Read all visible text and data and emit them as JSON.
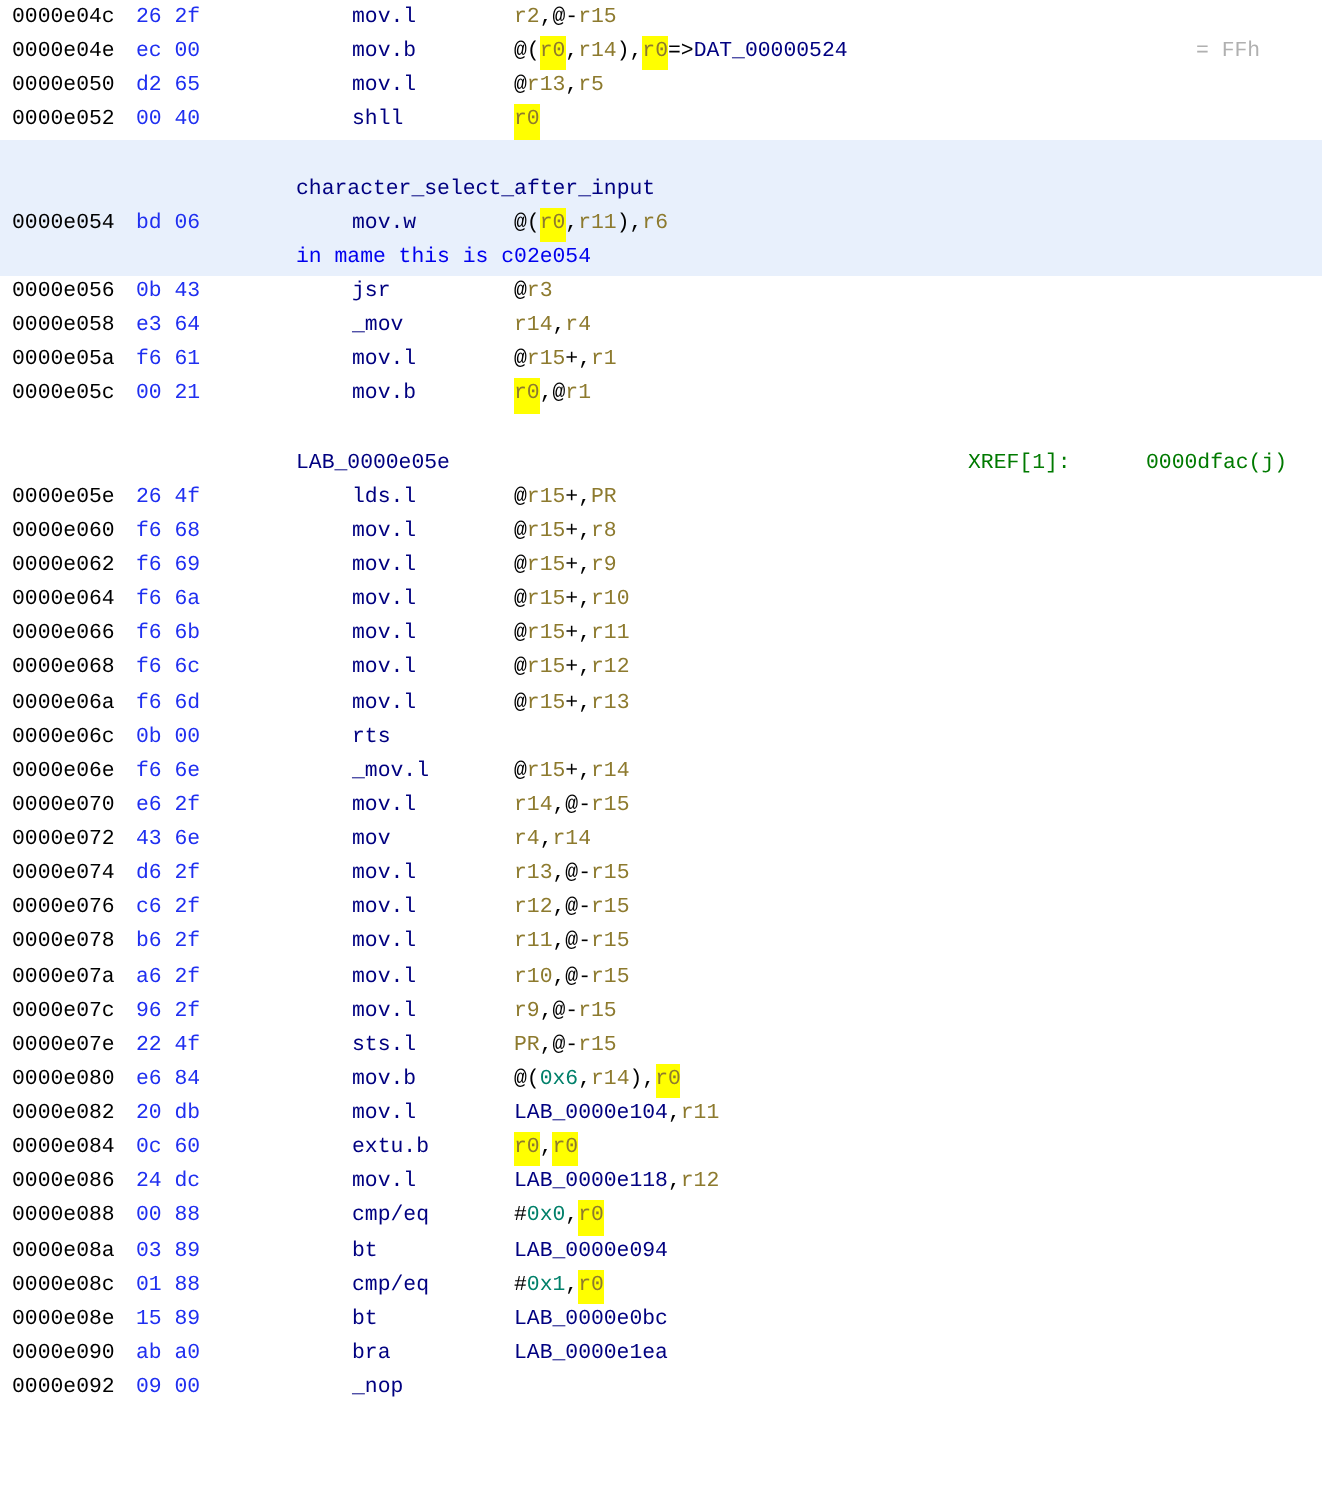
{
  "listing": [
    {
      "kind": "instruction",
      "selected": false,
      "address": "0000e04c",
      "bytes": "26 2f",
      "mnemonic": "mov.l",
      "operands": [
        {
          "text": "r2",
          "kind": "register",
          "highlighted": false
        },
        {
          "text": ",@-",
          "kind": "punct",
          "highlighted": false
        },
        {
          "text": "r15",
          "kind": "register",
          "highlighted": false
        }
      ]
    },
    {
      "kind": "instruction",
      "selected": false,
      "address": "0000e04e",
      "bytes": "ec 00",
      "mnemonic": "mov.b",
      "operands": [
        {
          "text": "@(",
          "kind": "punct",
          "highlighted": false
        },
        {
          "text": "r0",
          "kind": "register",
          "highlighted": true
        },
        {
          "text": ",",
          "kind": "punct",
          "highlighted": false
        },
        {
          "text": "r14",
          "kind": "register",
          "highlighted": false
        },
        {
          "text": "),",
          "kind": "punct",
          "highlighted": false
        },
        {
          "text": "r0",
          "kind": "register",
          "highlighted": true
        },
        {
          "text": "=>",
          "kind": "punct",
          "highlighted": false
        },
        {
          "text": "DAT_00000524",
          "kind": "label",
          "highlighted": false
        }
      ],
      "eol_comment": "= FFh"
    },
    {
      "kind": "instruction",
      "selected": false,
      "address": "0000e050",
      "bytes": "d2 65",
      "mnemonic": "mov.l",
      "operands": [
        {
          "text": "@",
          "kind": "punct",
          "highlighted": false
        },
        {
          "text": "r13",
          "kind": "register",
          "highlighted": false
        },
        {
          "text": ",",
          "kind": "punct",
          "highlighted": false
        },
        {
          "text": "r5",
          "kind": "register",
          "highlighted": false
        }
      ]
    },
    {
      "kind": "instruction",
      "selected": false,
      "address": "0000e052",
      "bytes": "00 40",
      "mnemonic": "shll",
      "operands": [
        {
          "text": "r0",
          "kind": "register",
          "highlighted": true
        }
      ]
    },
    {
      "kind": "label",
      "selected": true,
      "label": "character_select_after_input"
    },
    {
      "kind": "instruction",
      "selected": true,
      "address": "0000e054",
      "bytes": "bd 06",
      "mnemonic": "mov.w",
      "operands": [
        {
          "text": "@(",
          "kind": "punct",
          "highlighted": false
        },
        {
          "text": "r0",
          "kind": "register",
          "highlighted": true
        },
        {
          "text": ",",
          "kind": "punct",
          "highlighted": false
        },
        {
          "text": "r11",
          "kind": "register",
          "highlighted": false
        },
        {
          "text": "),",
          "kind": "punct",
          "highlighted": false
        },
        {
          "text": "r6",
          "kind": "register",
          "highlighted": false
        }
      ]
    },
    {
      "kind": "comment",
      "selected": true,
      "comment": "in mame this is c02e054"
    },
    {
      "kind": "instruction",
      "selected": false,
      "address": "0000e056",
      "bytes": "0b 43",
      "mnemonic": "jsr",
      "operands": [
        {
          "text": "@",
          "kind": "punct",
          "highlighted": false
        },
        {
          "text": "r3",
          "kind": "register",
          "highlighted": false
        }
      ]
    },
    {
      "kind": "instruction",
      "selected": false,
      "address": "0000e058",
      "bytes": "e3 64",
      "mnemonic": "_mov",
      "operands": [
        {
          "text": "r14",
          "kind": "register",
          "highlighted": false
        },
        {
          "text": ",",
          "kind": "punct",
          "highlighted": false
        },
        {
          "text": "r4",
          "kind": "register",
          "highlighted": false
        }
      ]
    },
    {
      "kind": "instruction",
      "selected": false,
      "address": "0000e05a",
      "bytes": "f6 61",
      "mnemonic": "mov.l",
      "operands": [
        {
          "text": "@",
          "kind": "punct",
          "highlighted": false
        },
        {
          "text": "r15",
          "kind": "register",
          "highlighted": false
        },
        {
          "text": "+,",
          "kind": "punct",
          "highlighted": false
        },
        {
          "text": "r1",
          "kind": "register",
          "highlighted": false
        }
      ]
    },
    {
      "kind": "instruction",
      "selected": false,
      "address": "0000e05c",
      "bytes": "00 21",
      "mnemonic": "mov.b",
      "operands": [
        {
          "text": "r0",
          "kind": "register",
          "highlighted": true
        },
        {
          "text": ",@",
          "kind": "punct",
          "highlighted": false
        },
        {
          "text": "r1",
          "kind": "register",
          "highlighted": false
        }
      ]
    },
    {
      "kind": "label",
      "selected": false,
      "label": "LAB_0000e05e",
      "xref": "XREF[1]:",
      "xref_target": "0000dfac(j)"
    },
    {
      "kind": "instruction",
      "selected": false,
      "address": "0000e05e",
      "bytes": "26 4f",
      "mnemonic": "lds.l",
      "operands": [
        {
          "text": "@",
          "kind": "punct",
          "highlighted": false
        },
        {
          "text": "r15",
          "kind": "register",
          "highlighted": false
        },
        {
          "text": "+,",
          "kind": "punct",
          "highlighted": false
        },
        {
          "text": "PR",
          "kind": "register",
          "highlighted": false
        }
      ]
    },
    {
      "kind": "instruction",
      "selected": false,
      "address": "0000e060",
      "bytes": "f6 68",
      "mnemonic": "mov.l",
      "operands": [
        {
          "text": "@",
          "kind": "punct",
          "highlighted": false
        },
        {
          "text": "r15",
          "kind": "register",
          "highlighted": false
        },
        {
          "text": "+,",
          "kind": "punct",
          "highlighted": false
        },
        {
          "text": "r8",
          "kind": "register",
          "highlighted": false
        }
      ]
    },
    {
      "kind": "instruction",
      "selected": false,
      "address": "0000e062",
      "bytes": "f6 69",
      "mnemonic": "mov.l",
      "operands": [
        {
          "text": "@",
          "kind": "punct",
          "highlighted": false
        },
        {
          "text": "r15",
          "kind": "register",
          "highlighted": false
        },
        {
          "text": "+,",
          "kind": "punct",
          "highlighted": false
        },
        {
          "text": "r9",
          "kind": "register",
          "highlighted": false
        }
      ]
    },
    {
      "kind": "instruction",
      "selected": false,
      "address": "0000e064",
      "bytes": "f6 6a",
      "mnemonic": "mov.l",
      "operands": [
        {
          "text": "@",
          "kind": "punct",
          "highlighted": false
        },
        {
          "text": "r15",
          "kind": "register",
          "highlighted": false
        },
        {
          "text": "+,",
          "kind": "punct",
          "highlighted": false
        },
        {
          "text": "r10",
          "kind": "register",
          "highlighted": false
        }
      ]
    },
    {
      "kind": "instruction",
      "selected": false,
      "address": "0000e066",
      "bytes": "f6 6b",
      "mnemonic": "mov.l",
      "operands": [
        {
          "text": "@",
          "kind": "punct",
          "highlighted": false
        },
        {
          "text": "r15",
          "kind": "register",
          "highlighted": false
        },
        {
          "text": "+,",
          "kind": "punct",
          "highlighted": false
        },
        {
          "text": "r11",
          "kind": "register",
          "highlighted": false
        }
      ]
    },
    {
      "kind": "instruction",
      "selected": false,
      "address": "0000e068",
      "bytes": "f6 6c",
      "mnemonic": "mov.l",
      "operands": [
        {
          "text": "@",
          "kind": "punct",
          "highlighted": false
        },
        {
          "text": "r15",
          "kind": "register",
          "highlighted": false
        },
        {
          "text": "+,",
          "kind": "punct",
          "highlighted": false
        },
        {
          "text": "r12",
          "kind": "register",
          "highlighted": false
        }
      ]
    },
    {
      "kind": "instruction",
      "selected": false,
      "address": "0000e06a",
      "bytes": "f6 6d",
      "mnemonic": "mov.l",
      "operands": [
        {
          "text": "@",
          "kind": "punct",
          "highlighted": false
        },
        {
          "text": "r15",
          "kind": "register",
          "highlighted": false
        },
        {
          "text": "+,",
          "kind": "punct",
          "highlighted": false
        },
        {
          "text": "r13",
          "kind": "register",
          "highlighted": false
        }
      ]
    },
    {
      "kind": "instruction",
      "selected": false,
      "address": "0000e06c",
      "bytes": "0b 00",
      "mnemonic": "rts"
    },
    {
      "kind": "instruction",
      "selected": false,
      "address": "0000e06e",
      "bytes": "f6 6e",
      "mnemonic": "_mov.l",
      "operands": [
        {
          "text": "@",
          "kind": "punct",
          "highlighted": false
        },
        {
          "text": "r15",
          "kind": "register",
          "highlighted": false
        },
        {
          "text": "+,",
          "kind": "punct",
          "highlighted": false
        },
        {
          "text": "r14",
          "kind": "register",
          "highlighted": false
        }
      ]
    },
    {
      "kind": "instruction",
      "selected": false,
      "address": "0000e070",
      "bytes": "e6 2f",
      "mnemonic": "mov.l",
      "operands": [
        {
          "text": "r14",
          "kind": "register",
          "highlighted": false
        },
        {
          "text": ",@-",
          "kind": "punct",
          "highlighted": false
        },
        {
          "text": "r15",
          "kind": "register",
          "highlighted": false
        }
      ]
    },
    {
      "kind": "instruction",
      "selected": false,
      "address": "0000e072",
      "bytes": "43 6e",
      "mnemonic": "mov",
      "operands": [
        {
          "text": "r4",
          "kind": "register",
          "highlighted": false
        },
        {
          "text": ",",
          "kind": "punct",
          "highlighted": false
        },
        {
          "text": "r14",
          "kind": "register",
          "highlighted": false
        }
      ]
    },
    {
      "kind": "instruction",
      "selected": false,
      "address": "0000e074",
      "bytes": "d6 2f",
      "mnemonic": "mov.l",
      "operands": [
        {
          "text": "r13",
          "kind": "register",
          "highlighted": false
        },
        {
          "text": ",@-",
          "kind": "punct",
          "highlighted": false
        },
        {
          "text": "r15",
          "kind": "register",
          "highlighted": false
        }
      ]
    },
    {
      "kind": "instruction",
      "selected": false,
      "address": "0000e076",
      "bytes": "c6 2f",
      "mnemonic": "mov.l",
      "operands": [
        {
          "text": "r12",
          "kind": "register",
          "highlighted": false
        },
        {
          "text": ",@-",
          "kind": "punct",
          "highlighted": false
        },
        {
          "text": "r15",
          "kind": "register",
          "highlighted": false
        }
      ]
    },
    {
      "kind": "instruction",
      "selected": false,
      "address": "0000e078",
      "bytes": "b6 2f",
      "mnemonic": "mov.l",
      "operands": [
        {
          "text": "r11",
          "kind": "register",
          "highlighted": false
        },
        {
          "text": ",@-",
          "kind": "punct",
          "highlighted": false
        },
        {
          "text": "r15",
          "kind": "register",
          "highlighted": false
        }
      ]
    },
    {
      "kind": "instruction",
      "selected": false,
      "address": "0000e07a",
      "bytes": "a6 2f",
      "mnemonic": "mov.l",
      "operands": [
        {
          "text": "r10",
          "kind": "register",
          "highlighted": false
        },
        {
          "text": ",@-",
          "kind": "punct",
          "highlighted": false
        },
        {
          "text": "r15",
          "kind": "register",
          "highlighted": false
        }
      ]
    },
    {
      "kind": "instruction",
      "selected": false,
      "address": "0000e07c",
      "bytes": "96 2f",
      "mnemonic": "mov.l",
      "operands": [
        {
          "text": "r9",
          "kind": "register",
          "highlighted": false
        },
        {
          "text": ",@-",
          "kind": "punct",
          "highlighted": false
        },
        {
          "text": "r15",
          "kind": "register",
          "highlighted": false
        }
      ]
    },
    {
      "kind": "instruction",
      "selected": false,
      "address": "0000e07e",
      "bytes": "22 4f",
      "mnemonic": "sts.l",
      "operands": [
        {
          "text": "PR",
          "kind": "register",
          "highlighted": false
        },
        {
          "text": ",@-",
          "kind": "punct",
          "highlighted": false
        },
        {
          "text": "r15",
          "kind": "register",
          "highlighted": false
        }
      ]
    },
    {
      "kind": "instruction",
      "selected": false,
      "address": "0000e080",
      "bytes": "e6 84",
      "mnemonic": "mov.b",
      "operands": [
        {
          "text": "@(",
          "kind": "punct",
          "highlighted": false
        },
        {
          "text": "0x6",
          "kind": "immediate",
          "highlighted": false
        },
        {
          "text": ",",
          "kind": "punct",
          "highlighted": false
        },
        {
          "text": "r14",
          "kind": "register",
          "highlighted": false
        },
        {
          "text": "),",
          "kind": "punct",
          "highlighted": false
        },
        {
          "text": "r0",
          "kind": "register",
          "highlighted": true
        }
      ]
    },
    {
      "kind": "instruction",
      "selected": false,
      "address": "0000e082",
      "bytes": "20 db",
      "mnemonic": "mov.l",
      "operands": [
        {
          "text": "LAB_0000e104",
          "kind": "label",
          "highlighted": false
        },
        {
          "text": ",",
          "kind": "punct",
          "highlighted": false
        },
        {
          "text": "r11",
          "kind": "register",
          "highlighted": false
        }
      ]
    },
    {
      "kind": "instruction",
      "selected": false,
      "address": "0000e084",
      "bytes": "0c 60",
      "mnemonic": "extu.b",
      "operands": [
        {
          "text": "r0",
          "kind": "register",
          "highlighted": true
        },
        {
          "text": ",",
          "kind": "punct",
          "highlighted": false
        },
        {
          "text": "r0",
          "kind": "register",
          "highlighted": true
        }
      ]
    },
    {
      "kind": "instruction",
      "selected": false,
      "address": "0000e086",
      "bytes": "24 dc",
      "mnemonic": "mov.l",
      "operands": [
        {
          "text": "LAB_0000e118",
          "kind": "label",
          "highlighted": false
        },
        {
          "text": ",",
          "kind": "punct",
          "highlighted": false
        },
        {
          "text": "r12",
          "kind": "register",
          "highlighted": false
        }
      ]
    },
    {
      "kind": "instruction",
      "selected": false,
      "address": "0000e088",
      "bytes": "00 88",
      "mnemonic": "cmp/eq",
      "operands": [
        {
          "text": "#",
          "kind": "punct",
          "highlighted": false
        },
        {
          "text": "0x0",
          "kind": "immediate",
          "highlighted": false
        },
        {
          "text": ",",
          "kind": "punct",
          "highlighted": false
        },
        {
          "text": "r0",
          "kind": "register",
          "highlighted": true
        }
      ]
    },
    {
      "kind": "instruction",
      "selected": false,
      "address": "0000e08a",
      "bytes": "03 89",
      "mnemonic": "bt",
      "operands": [
        {
          "text": "LAB_0000e094",
          "kind": "label",
          "highlighted": false
        }
      ]
    },
    {
      "kind": "instruction",
      "selected": false,
      "address": "0000e08c",
      "bytes": "01 88",
      "mnemonic": "cmp/eq",
      "operands": [
        {
          "text": "#",
          "kind": "punct",
          "highlighted": false
        },
        {
          "text": "0x1",
          "kind": "immediate",
          "highlighted": false
        },
        {
          "text": ",",
          "kind": "punct",
          "highlighted": false
        },
        {
          "text": "r0",
          "kind": "register",
          "highlighted": true
        }
      ]
    },
    {
      "kind": "instruction",
      "selected": false,
      "address": "0000e08e",
      "bytes": "15 89",
      "mnemonic": "bt",
      "operands": [
        {
          "text": "LAB_0000e0bc",
          "kind": "label",
          "highlighted": false
        }
      ]
    },
    {
      "kind": "instruction",
      "selected": false,
      "address": "0000e090",
      "bytes": "ab a0",
      "mnemonic": "bra",
      "operands": [
        {
          "text": "LAB_0000e1ea",
          "kind": "label",
          "highlighted": false
        }
      ]
    },
    {
      "kind": "instruction",
      "selected": false,
      "address": "0000e092",
      "bytes": "09 00",
      "mnemonic": "_nop"
    }
  ]
}
